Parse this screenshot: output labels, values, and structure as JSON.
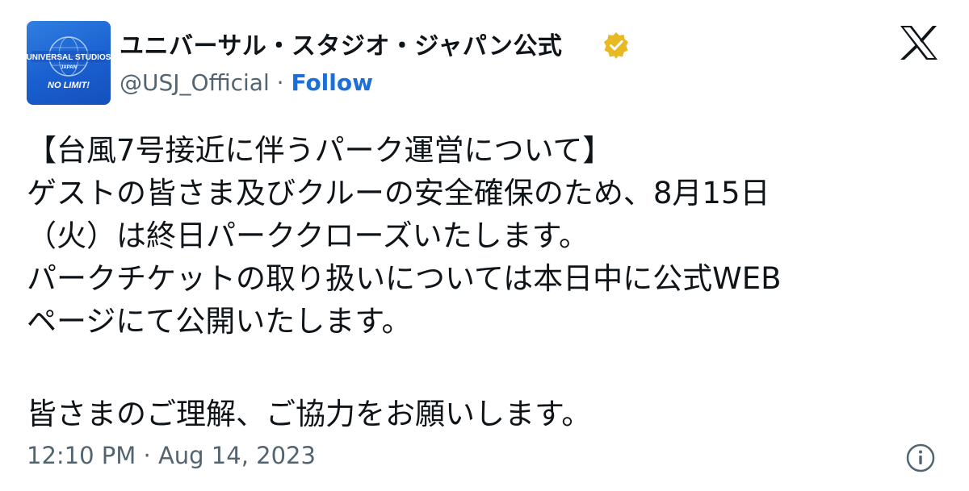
{
  "author": {
    "name": "ユニバーサル・スタジオ・ジャパン公式",
    "handle": "@USJ_Official",
    "separator": " · ",
    "follow_label": "Follow",
    "avatar_logo": {
      "line1": "UNIVERSAL STUDIOS",
      "line2": "JAPAN",
      "line3": "NO LIMIT!"
    },
    "verified_color": "#e8b923"
  },
  "tweet": {
    "lines": [
      "【台風7号接近に伴うパーク運営について】",
      "ゲストの皆さま及びクルーの安全確保のため、8月15日",
      "（火）は終日パーククローズいたします。",
      "パークチケットの取り扱いについては本日中に公式WEB",
      "ページにて公開いたします。"
    ],
    "closing": "皆さまのご理解、ご協力をお願いします。"
  },
  "footer": {
    "timestamp": "12:10 PM · Aug 14, 2023",
    "info_icon": "info-icon"
  },
  "icons": {
    "platform_logo": "x-logo-icon",
    "verified": "verified-badge-icon"
  },
  "colors": {
    "text": "#0f1419",
    "secondary_text": "#536471",
    "link": "#1d6fd8",
    "avatar_bg": "#1a5fd0"
  }
}
